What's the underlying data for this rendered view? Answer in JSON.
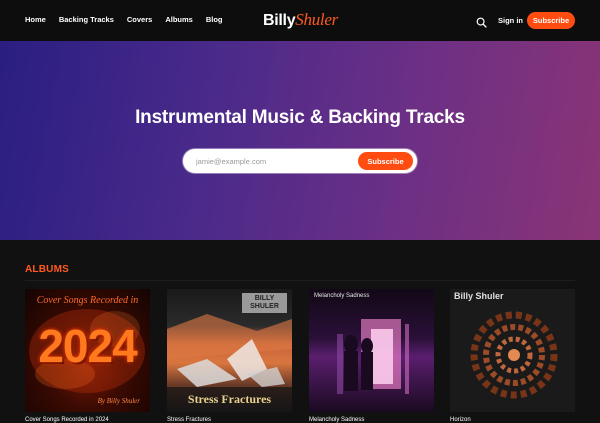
{
  "nav": {
    "items": [
      "Home",
      "Backing Tracks",
      "Covers",
      "Albums",
      "Blog"
    ]
  },
  "logo": {
    "first": "Billy",
    "last": "Shuler"
  },
  "header": {
    "search_icon": "search-icon",
    "signin_label": "Sign in",
    "subscribe_label": "Subscribe"
  },
  "hero": {
    "title": "Instrumental Music & Backing Tracks",
    "email_placeholder": "jamie@example.com",
    "subscribe_label": "Subscribe"
  },
  "albums": {
    "heading": "ALBUMS",
    "items": [
      {
        "title": "Cover Songs Recorded in 2024",
        "cover_top": "Cover Songs Recorded in",
        "cover_year": "2024",
        "cover_byline": "By Billy Shuler"
      },
      {
        "title": "Stress Fractures",
        "cover_text": "Stress Fractures",
        "cover_badge": "BILLY SHULER"
      },
      {
        "title": "Melancholy Sadness",
        "cover_text": "Melancholy Sadness"
      },
      {
        "title": "Horizon",
        "cover_text": "Billy Shuler"
      }
    ]
  },
  "colors": {
    "accent": "#ff4d12",
    "background": "#111111",
    "header": "#0d0d0d"
  }
}
